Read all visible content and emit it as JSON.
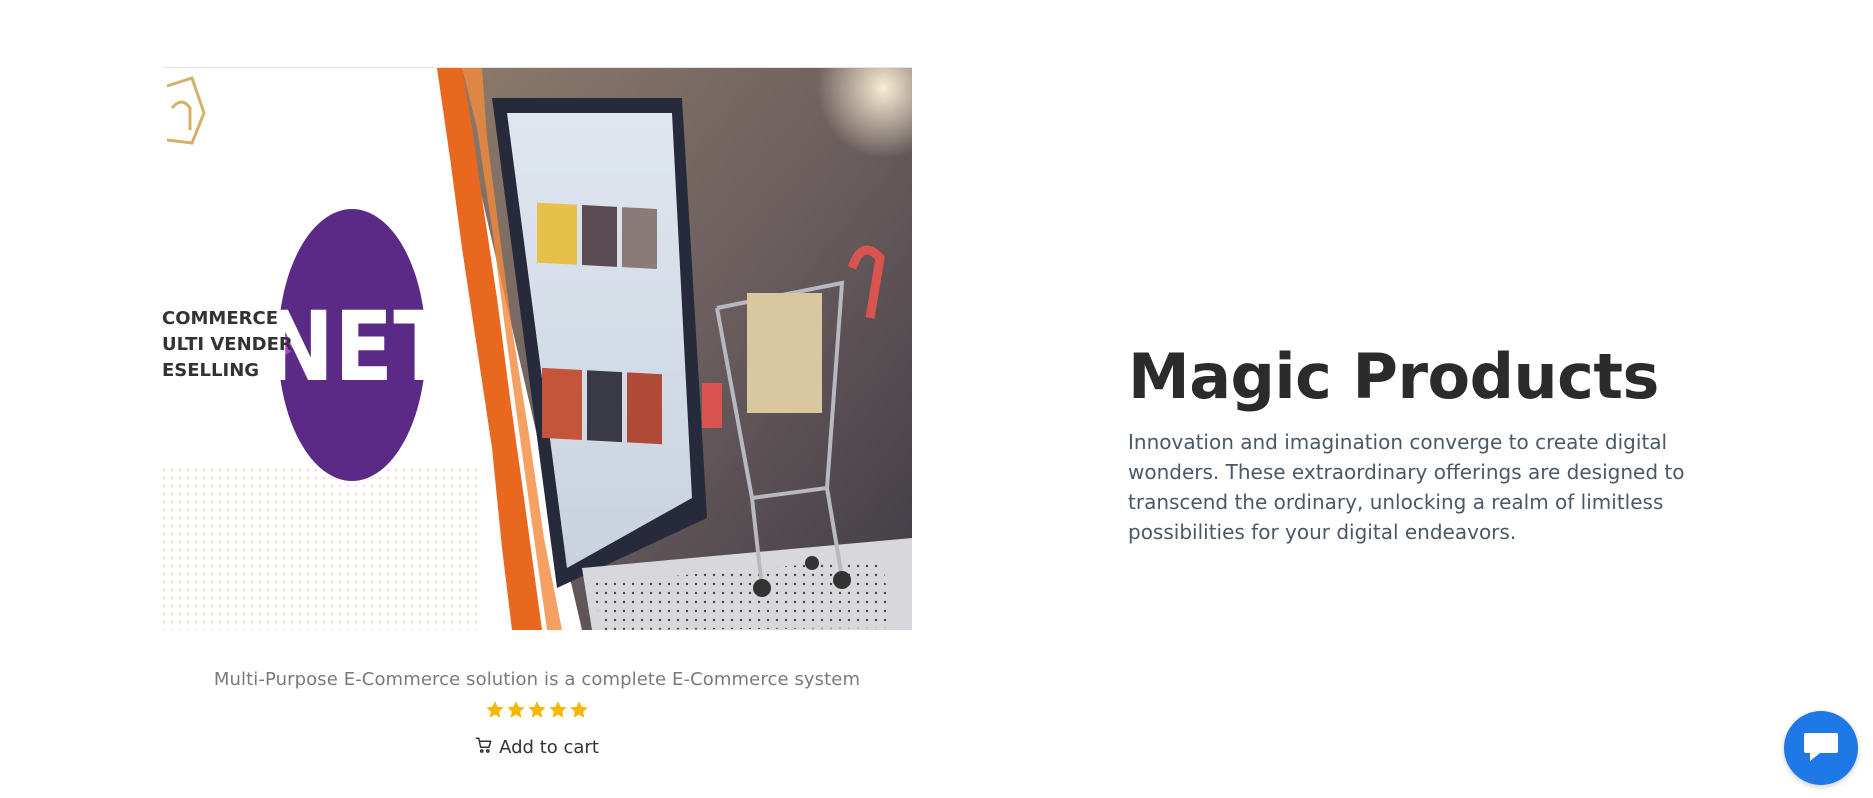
{
  "product": {
    "image_text": {
      "lines": [
        "COMMERCE",
        "ULTI VENDER",
        "ESELLING"
      ],
      "badge": "NET"
    },
    "title": "Multi-Purpose E-Commerce solution is a complete E-Commerce system",
    "rating": {
      "value": 5,
      "max": 5,
      "color": "#f5b800"
    },
    "add_to_cart_label": "Add to cart"
  },
  "hero": {
    "title": "Magic Products",
    "description": "Innovation and imagination converge to create digital wonders. These extraordinary offerings are designed to transcend the ordinary, unlocking a realm of limitless possibilities for your digital endeavors."
  },
  "chat": {
    "icon": "chat-bubble-icon",
    "color": "#1e78e6"
  }
}
